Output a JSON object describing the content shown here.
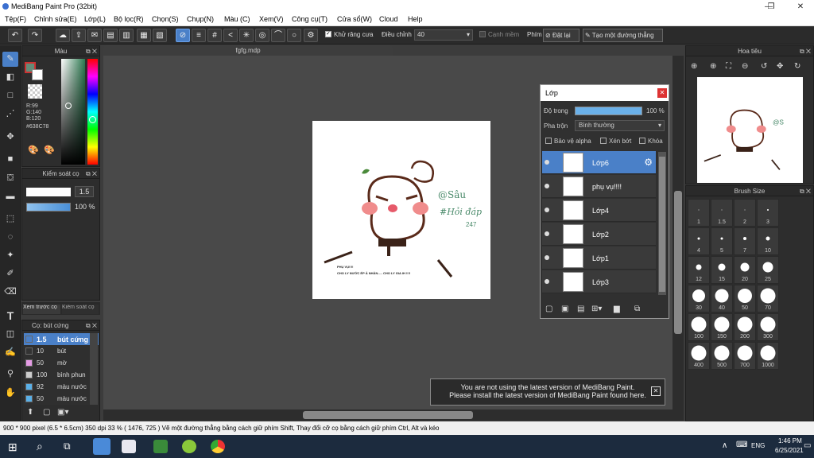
{
  "window": {
    "title": "MediBang Paint Pro (32bit)",
    "min": "—",
    "max": "❐",
    "close": "✕"
  },
  "menu": [
    "Tệp(F)",
    "Chỉnh sửa(E)",
    "Lớp(L)",
    "Bộ lọc(R)",
    "Chọn(S)",
    "Chụp(N)",
    "Màu (C)",
    "Xem(V)",
    "Công cụ(T)",
    "Cửa sổ(W)",
    "Cloud",
    "Help"
  ],
  "toolbar": {
    "antialias_label": "Khử răng cưa",
    "adjust_label": "Điều chỉnh",
    "adjust_value": "40",
    "smooth_label": "Cạnh mềm",
    "key_label": "Phím",
    "reset_label": "Đặt lại",
    "line_label": "Tạo một đường thẳng"
  },
  "color_panel": {
    "title": "Màu",
    "r": "R:99",
    "g": "G:140",
    "b": "B:120",
    "hex": "#638C78",
    "primary": "#638C78",
    "secondary": "#ffffff"
  },
  "brush_control": {
    "title": "Kiểm soát cọ",
    "size": "1.5",
    "opacity": "100 %"
  },
  "left_tabs": {
    "preview": "Xem trước cọ",
    "control": "Kiểm soát cọ"
  },
  "brush_list": {
    "title": "Cọ: bút cứng",
    "items": [
      {
        "size": "1.5",
        "name": "bút cứng",
        "color": "#4a80c8",
        "sel": true
      },
      {
        "size": "10",
        "name": "bút",
        "color": "#333333"
      },
      {
        "size": "50",
        "name": "mờ",
        "color": "#e69ce6"
      },
      {
        "size": "100",
        "name": "bình phun",
        "color": "#cccccc"
      },
      {
        "size": "92",
        "name": "màu nước",
        "color": "#5ab0e8"
      },
      {
        "size": "50",
        "name": "màu nước",
        "color": "#5ab0e8"
      }
    ]
  },
  "document": {
    "tab": "fgfg.mdp"
  },
  "drawing": {
    "handle": "@Sâu",
    "tag": "#Hỏi đáp",
    "num": "247",
    "caption1": "PHỤ VỤ!!!!",
    "caption2": "CHO LY NƯỚC ÉP Ả NHÂN..... CHO LY GIA IH !!!!"
  },
  "layer_panel": {
    "title": "Lớp",
    "opacity_label": "Độ trong",
    "opacity_value": "100 %",
    "blend_label": "Pha trộn",
    "blend_value": "Bình thường",
    "protect_alpha": "Bảo vệ alpha",
    "clip": "Xén bớt",
    "lock": "Khóa",
    "layers": [
      {
        "name": "Lớp6",
        "sel": true
      },
      {
        "name": "phụ vụ!!!!"
      },
      {
        "name": "Lớp4"
      },
      {
        "name": "Lớp2"
      },
      {
        "name": "Lớp1"
      },
      {
        "name": "Lớp3"
      }
    ]
  },
  "navigator": {
    "title": "Hoa tiêu"
  },
  "brush_size": {
    "title": "Brush Size",
    "sizes": [
      "1",
      "1.5",
      "2",
      "3",
      "4",
      "5",
      "7",
      "10",
      "12",
      "15",
      "20",
      "25",
      "30",
      "40",
      "50",
      "70",
      "100",
      "150",
      "200",
      "300",
      "400",
      "500",
      "700",
      "1000"
    ]
  },
  "notice": {
    "line1": "You are not using the latest version of MediBang Paint.",
    "line2": "Please install the latest version of MediBang Paint found here."
  },
  "status": {
    "text": "900 * 900 pixel  (6.5 * 6.5cm)  350 dpi  33 %  ( 1476, 725 )  Vẽ một đường thẳng bằng cách giữ phím Shift, Thay đổi cỡ cọ bằng cách giữ phím Ctrl, Alt và kéo"
  },
  "taskbar": {
    "lang": "ENG",
    "time": "1:46 PM",
    "date": "6/25/2021"
  }
}
